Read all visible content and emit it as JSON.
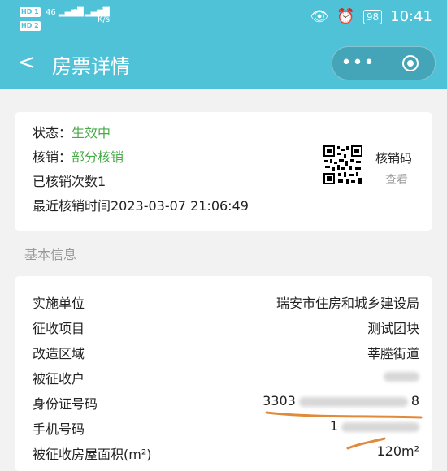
{
  "status_bar": {
    "hd1": "HD 1",
    "hd2": "HD 2",
    "signal1": "46",
    "signal2": "46",
    "speed_value": "0",
    "speed_unit": "K/s",
    "battery": "98",
    "time": "10:41"
  },
  "nav": {
    "back": "<",
    "title": "房票详情",
    "more": "•••"
  },
  "status": {
    "status_label": "状态：",
    "status_value": "生效中",
    "verify_label": "核销：",
    "verify_value": "部分核销",
    "verified_count": "已核销次数1",
    "last_verify_time": "最近核销时间2023-03-07 21:06:49",
    "qr_label": "核销码",
    "qr_view": "查看"
  },
  "basic_info": {
    "section_title": "基本信息",
    "rows": [
      {
        "label": "实施单位",
        "value": "瑞安市住房和城乡建设局"
      },
      {
        "label": "征收项目",
        "value": "测试团块"
      },
      {
        "label": "改造区域",
        "value": "莘塍街道"
      },
      {
        "label": "被征收户",
        "value": ""
      },
      {
        "label": "身份证号码",
        "value_prefix": "3303",
        "value_suffix": "8"
      },
      {
        "label": "手机号码",
        "value_prefix": "1"
      },
      {
        "label": "被征收房屋面积(m²)",
        "value": "120m²"
      }
    ]
  },
  "colors": {
    "header": "#4fc2d8",
    "status_green": "#4aaa4a",
    "muted": "#999999",
    "scribble": "#e08a3c"
  }
}
